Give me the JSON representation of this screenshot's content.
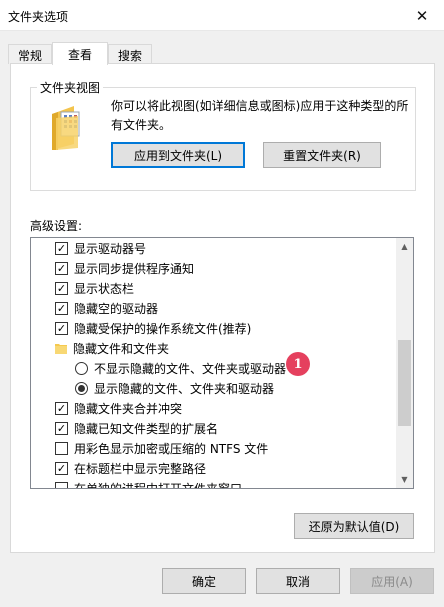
{
  "window": {
    "title": "文件夹选项"
  },
  "tabs": [
    {
      "label": "常规"
    },
    {
      "label": "查看",
      "active": true
    },
    {
      "label": "搜索"
    }
  ],
  "folder_views": {
    "title": "文件夹视图",
    "description": "你可以将此视图(如详细信息或图标)应用于这种类型的所有文件夹。",
    "apply_button": "应用到文件夹(L)",
    "reset_button": "重置文件夹(R)"
  },
  "advanced": {
    "label": "高级设置:",
    "items": [
      {
        "type": "checkbox",
        "checked": true,
        "label": "显示驱动器号"
      },
      {
        "type": "checkbox",
        "checked": true,
        "label": "显示同步提供程序通知"
      },
      {
        "type": "checkbox",
        "checked": true,
        "label": "显示状态栏"
      },
      {
        "type": "checkbox",
        "checked": true,
        "label": "隐藏空的驱动器"
      },
      {
        "type": "checkbox",
        "checked": true,
        "label": "隐藏受保护的操作系统文件(推荐)"
      },
      {
        "type": "folder",
        "label": "隐藏文件和文件夹"
      },
      {
        "type": "radio",
        "checked": false,
        "label": "不显示隐藏的文件、文件夹或驱动器"
      },
      {
        "type": "radio",
        "checked": true,
        "label": "显示隐藏的文件、文件夹和驱动器"
      },
      {
        "type": "checkbox",
        "checked": true,
        "label": "隐藏文件夹合并冲突"
      },
      {
        "type": "checkbox",
        "checked": true,
        "label": "隐藏已知文件类型的扩展名"
      },
      {
        "type": "checkbox",
        "checked": false,
        "label": "用彩色显示加密或压缩的 NTFS 文件"
      },
      {
        "type": "checkbox",
        "checked": true,
        "label": "在标题栏中显示完整路径"
      },
      {
        "type": "checkbox",
        "checked": false,
        "label": "在单独的进程中打开文件夹窗口"
      }
    ],
    "restore_button": "还原为默认值(D)"
  },
  "annotation": {
    "badge": "1"
  },
  "footer": {
    "ok": "确定",
    "cancel": "取消",
    "apply": "应用(A)"
  },
  "colors": {
    "accent": "#0078d7",
    "badge": "#e5405e",
    "dialog_bg": "#f0f0f0"
  }
}
